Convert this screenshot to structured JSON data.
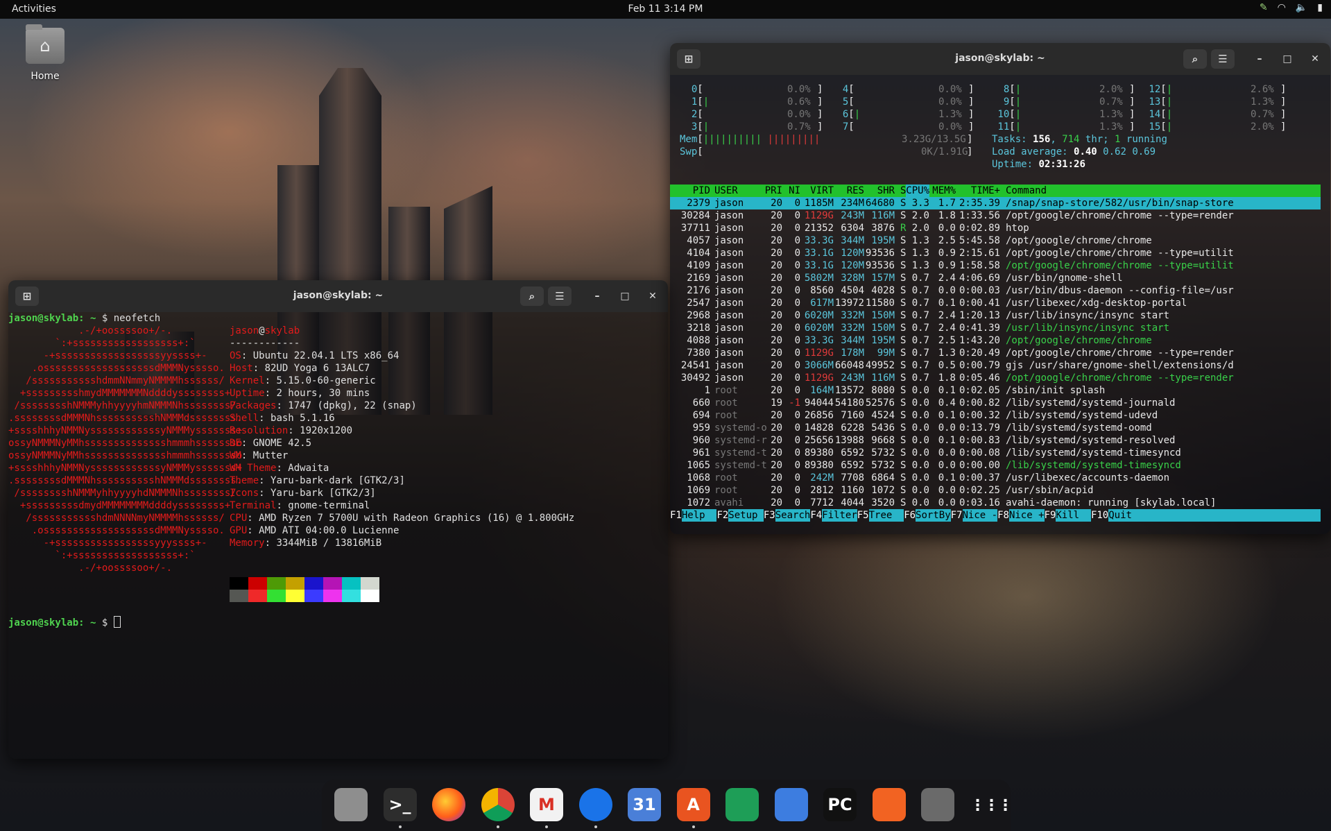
{
  "topbar": {
    "activities": "Activities",
    "clock": "Feb 11  3:14 PM",
    "tray_icons": [
      "pen-icon",
      "wifi-icon",
      "volume-icon",
      "battery-icon"
    ]
  },
  "desktop": {
    "home_label": "Home"
  },
  "neofetch_window": {
    "title": "jason@skylab: ~",
    "prompt_user": "jason@skylab",
    "prompt_path": ": ~",
    "prompt_symbol": " $ ",
    "command": "neofetch",
    "art_lines": [
      "            .-/+oossssoo+/-.",
      "        `:+ssssssssssssssssss+:`",
      "      -+ssssssssssssssssssyyssss+-",
      "    .osssssssssssssssssssdMMMNysssso.",
      "   /ssssssssssshdmmNNmmyNMMMMhssssss/",
      "  +ssssssssshmydMMMMMMMNddddyssssssss+",
      " /sssssssshNMMMyhhyyyyhmNMMMNhssssssss/",
      ".ssssssssdMMMNhsssssssssshNMMMdssssssss.",
      "+sssshhhyNMMNyssssssssssssyNMMMysssssss+",
      "ossyNMMMNyMMhsssssssssssssshmmmhssssssso",
      "ossyNMMMNyMMhsssssssssssssshmmmhssssssso",
      "+sssshhhyNMMNyssssssssssssyNMMMysssssss+",
      ".ssssssssdMMMNhsssssssssshNMMMdssssssss.",
      " /sssssssshNMMMyhhyyyyhdNMMMNhssssssss/",
      "  +sssssssssdmydMMMMMMMMddddyssssssss+",
      "   /ssssssssssshdmNNNNmyNMMMMhssssss/",
      "    .osssssssssssssssssssdMMMNysssso.",
      "      -+sssssssssssssssssyyyssss+-",
      "        `:+ssssssssssssssssss+:`",
      "            .-/+oossssoo+/-."
    ],
    "info_header_user": "jason",
    "info_header_at": "@",
    "info_header_host": "skylab",
    "info_sep": "------------",
    "info": [
      {
        "key": "OS",
        "value": "Ubuntu 22.04.1 LTS x86_64"
      },
      {
        "key": "Host",
        "value": "82UD Yoga 6 13ALC7"
      },
      {
        "key": "Kernel",
        "value": "5.15.0-60-generic"
      },
      {
        "key": "Uptime",
        "value": "2 hours, 30 mins"
      },
      {
        "key": "Packages",
        "value": "1747 (dpkg), 22 (snap)"
      },
      {
        "key": "Shell",
        "value": "bash 5.1.16"
      },
      {
        "key": "Resolution",
        "value": "1920x1200"
      },
      {
        "key": "DE",
        "value": "GNOME 42.5"
      },
      {
        "key": "WM",
        "value": "Mutter"
      },
      {
        "key": "WM Theme",
        "value": "Adwaita"
      },
      {
        "key": "Theme",
        "value": "Yaru-bark-dark [GTK2/3]"
      },
      {
        "key": "Icons",
        "value": "Yaru-bark [GTK2/3]"
      },
      {
        "key": "Terminal",
        "value": "gnome-terminal"
      },
      {
        "key": "CPU",
        "value": "AMD Ryzen 7 5700U with Radeon Graphics (16) @ 1.800GHz"
      },
      {
        "key": "GPU",
        "value": "AMD ATI 04:00.0 Lucienne"
      },
      {
        "key": "Memory",
        "value": "3344MiB / 13816MiB"
      }
    ],
    "palette_top": [
      "#000000",
      "#cc0000",
      "#4e9a06",
      "#c4a000",
      "#1a14cc",
      "#b514b5",
      "#06c1c1",
      "#d3d7cf"
    ],
    "palette_bottom": [
      "#555753",
      "#ef2929",
      "#33e033",
      "#ffff33",
      "#3b3bff",
      "#ee33ee",
      "#33e0e0",
      "#ffffff"
    ]
  },
  "htop_window": {
    "title": "jason@skylab: ~",
    "cpus": [
      {
        "id": "0",
        "pct": "0.0%"
      },
      {
        "id": "1",
        "pct": "0.6%"
      },
      {
        "id": "2",
        "pct": "0.0%"
      },
      {
        "id": "3",
        "pct": "0.7%"
      },
      {
        "id": "4",
        "pct": "0.0%"
      },
      {
        "id": "5",
        "pct": "0.0%"
      },
      {
        "id": "6",
        "pct": "1.3%"
      },
      {
        "id": "7",
        "pct": "0.0%"
      },
      {
        "id": "8",
        "pct": "2.0%"
      },
      {
        "id": "9",
        "pct": "0.7%"
      },
      {
        "id": "10",
        "pct": "1.3%"
      },
      {
        "id": "11",
        "pct": "1.3%"
      },
      {
        "id": "12",
        "pct": "2.6%"
      },
      {
        "id": "13",
        "pct": "1.3%"
      },
      {
        "id": "14",
        "pct": "0.7%"
      },
      {
        "id": "15",
        "pct": "2.0%"
      }
    ],
    "mem_label": "Mem",
    "mem_value": "3.23G/13.5G",
    "swp_label": "Swp",
    "swp_value": "0K/1.91G",
    "tasks_label": "Tasks:",
    "tasks_count": "156",
    "tasks_thr": "714",
    "tasks_rest": " thr; ",
    "tasks_running_count": "1",
    "tasks_running": " running",
    "load_label": "Load average:",
    "load1": "0.40",
    "load5": "0.62",
    "load15": "0.69",
    "uptime_label": "Uptime:",
    "uptime_value": "02:31:26",
    "columns": [
      "PID",
      "USER",
      "PRI",
      "NI",
      "VIRT",
      "RES",
      "SHR",
      "S",
      "CPU%",
      "MEM%",
      "TIME+",
      "Command"
    ],
    "processes": [
      {
        "pid": "2379",
        "user": "jason",
        "pri": "20",
        "ni": "0",
        "virt": "1185M",
        "res": "234M",
        "shr": "64680",
        "s": "S",
        "cpu": "3.3",
        "mem": "1.7",
        "time": "2:35.39",
        "cmd": "/snap/snap-store/582/usr/bin/snap-store",
        "selected": true
      },
      {
        "pid": "30284",
        "user": "jason",
        "pri": "20",
        "ni": "0",
        "virt": "1129G",
        "res": "243M",
        "shr": "116M",
        "s": "S",
        "cpu": "2.0",
        "mem": "1.8",
        "time": "1:33.56",
        "cmd": "/opt/google/chrome/chrome --type=render"
      },
      {
        "pid": "37711",
        "user": "jason",
        "pri": "20",
        "ni": "0",
        "virt": "21352",
        "res": "6304",
        "shr": "3876",
        "s": "R",
        "cpu": "2.0",
        "mem": "0.0",
        "time": "0:02.89",
        "cmd": "htop"
      },
      {
        "pid": "4057",
        "user": "jason",
        "pri": "20",
        "ni": "0",
        "virt": "33.3G",
        "res": "344M",
        "shr": "195M",
        "s": "S",
        "cpu": "1.3",
        "mem": "2.5",
        "time": "5:45.58",
        "cmd": "/opt/google/chrome/chrome"
      },
      {
        "pid": "4104",
        "user": "jason",
        "pri": "20",
        "ni": "0",
        "virt": "33.1G",
        "res": "120M",
        "shr": "93536",
        "s": "S",
        "cpu": "1.3",
        "mem": "0.9",
        "time": "2:15.61",
        "cmd": "/opt/google/chrome/chrome --type=utilit"
      },
      {
        "pid": "4109",
        "user": "jason",
        "pri": "20",
        "ni": "0",
        "virt": "33.1G",
        "res": "120M",
        "shr": "93536",
        "s": "S",
        "cpu": "1.3",
        "mem": "0.9",
        "time": "1:58.58",
        "cmd": "/opt/google/chrome/chrome --type=utilit",
        "thread": true
      },
      {
        "pid": "2169",
        "user": "jason",
        "pri": "20",
        "ni": "0",
        "virt": "5802M",
        "res": "328M",
        "shr": "157M",
        "s": "S",
        "cpu": "0.7",
        "mem": "2.4",
        "time": "4:06.69",
        "cmd": "/usr/bin/gnome-shell"
      },
      {
        "pid": "2176",
        "user": "jason",
        "pri": "20",
        "ni": "0",
        "virt": "8560",
        "res": "4504",
        "shr": "4028",
        "s": "S",
        "cpu": "0.7",
        "mem": "0.0",
        "time": "0:00.03",
        "cmd": "/usr/bin/dbus-daemon --config-file=/usr"
      },
      {
        "pid": "2547",
        "user": "jason",
        "pri": "20",
        "ni": "0",
        "virt": "617M",
        "res": "13972",
        "shr": "11580",
        "s": "S",
        "cpu": "0.7",
        "mem": "0.1",
        "time": "0:00.41",
        "cmd": "/usr/libexec/xdg-desktop-portal"
      },
      {
        "pid": "2968",
        "user": "jason",
        "pri": "20",
        "ni": "0",
        "virt": "6020M",
        "res": "332M",
        "shr": "150M",
        "s": "S",
        "cpu": "0.7",
        "mem": "2.4",
        "time": "1:20.13",
        "cmd": "/usr/lib/insync/insync start"
      },
      {
        "pid": "3218",
        "user": "jason",
        "pri": "20",
        "ni": "0",
        "virt": "6020M",
        "res": "332M",
        "shr": "150M",
        "s": "S",
        "cpu": "0.7",
        "mem": "2.4",
        "time": "0:41.39",
        "cmd": "/usr/lib/insync/insync start",
        "thread": true
      },
      {
        "pid": "4088",
        "user": "jason",
        "pri": "20",
        "ni": "0",
        "virt": "33.3G",
        "res": "344M",
        "shr": "195M",
        "s": "S",
        "cpu": "0.7",
        "mem": "2.5",
        "time": "1:43.20",
        "cmd": "/opt/google/chrome/chrome",
        "thread": true
      },
      {
        "pid": "7380",
        "user": "jason",
        "pri": "20",
        "ni": "0",
        "virt": "1129G",
        "res": "178M",
        "shr": "99M",
        "s": "S",
        "cpu": "0.7",
        "mem": "1.3",
        "time": "0:20.49",
        "cmd": "/opt/google/chrome/chrome --type=render"
      },
      {
        "pid": "24541",
        "user": "jason",
        "pri": "20",
        "ni": "0",
        "virt": "3066M",
        "res": "66048",
        "shr": "49952",
        "s": "S",
        "cpu": "0.7",
        "mem": "0.5",
        "time": "0:00.79",
        "cmd": "gjs /usr/share/gnome-shell/extensions/d"
      },
      {
        "pid": "30492",
        "user": "jason",
        "pri": "20",
        "ni": "0",
        "virt": "1129G",
        "res": "243M",
        "shr": "116M",
        "s": "S",
        "cpu": "0.7",
        "mem": "1.8",
        "time": "0:05.46",
        "cmd": "/opt/google/chrome/chrome --type=render",
        "thread": true
      },
      {
        "pid": "1",
        "user": "root",
        "pri": "20",
        "ni": "0",
        "virt": "164M",
        "res": "13572",
        "shr": "8080",
        "s": "S",
        "cpu": "0.0",
        "mem": "0.1",
        "time": "0:02.05",
        "cmd": "/sbin/init splash"
      },
      {
        "pid": "660",
        "user": "root",
        "pri": "19",
        "ni": "-1",
        "virt": "94044",
        "res": "54180",
        "shr": "52576",
        "s": "S",
        "cpu": "0.0",
        "mem": "0.4",
        "time": "0:00.82",
        "cmd": "/lib/systemd/systemd-journald"
      },
      {
        "pid": "694",
        "user": "root",
        "pri": "20",
        "ni": "0",
        "virt": "26856",
        "res": "7160",
        "shr": "4524",
        "s": "S",
        "cpu": "0.0",
        "mem": "0.1",
        "time": "0:00.32",
        "cmd": "/lib/systemd/systemd-udevd"
      },
      {
        "pid": "959",
        "user": "systemd-o",
        "pri": "20",
        "ni": "0",
        "virt": "14828",
        "res": "6228",
        "shr": "5436",
        "s": "S",
        "cpu": "0.0",
        "mem": "0.0",
        "time": "0:13.79",
        "cmd": "/lib/systemd/systemd-oomd"
      },
      {
        "pid": "960",
        "user": "systemd-r",
        "pri": "20",
        "ni": "0",
        "virt": "25656",
        "res": "13988",
        "shr": "9668",
        "s": "S",
        "cpu": "0.0",
        "mem": "0.1",
        "time": "0:00.83",
        "cmd": "/lib/systemd/systemd-resolved"
      },
      {
        "pid": "961",
        "user": "systemd-t",
        "pri": "20",
        "ni": "0",
        "virt": "89380",
        "res": "6592",
        "shr": "5732",
        "s": "S",
        "cpu": "0.0",
        "mem": "0.0",
        "time": "0:00.08",
        "cmd": "/lib/systemd/systemd-timesyncd"
      },
      {
        "pid": "1065",
        "user": "systemd-t",
        "pri": "20",
        "ni": "0",
        "virt": "89380",
        "res": "6592",
        "shr": "5732",
        "s": "S",
        "cpu": "0.0",
        "mem": "0.0",
        "time": "0:00.00",
        "cmd": "/lib/systemd/systemd-timesyncd",
        "thread": true
      },
      {
        "pid": "1068",
        "user": "root",
        "pri": "20",
        "ni": "0",
        "virt": "242M",
        "res": "7708",
        "shr": "6864",
        "s": "S",
        "cpu": "0.0",
        "mem": "0.1",
        "time": "0:00.37",
        "cmd": "/usr/libexec/accounts-daemon"
      },
      {
        "pid": "1069",
        "user": "root",
        "pri": "20",
        "ni": "0",
        "virt": "2812",
        "res": "1160",
        "shr": "1072",
        "s": "S",
        "cpu": "0.0",
        "mem": "0.0",
        "time": "0:02.25",
        "cmd": "/usr/sbin/acpid"
      },
      {
        "pid": "1072",
        "user": "avahi",
        "pri": "20",
        "ni": "0",
        "virt": "7712",
        "res": "4044",
        "shr": "3520",
        "s": "S",
        "cpu": "0.0",
        "mem": "0.0",
        "time": "0:03.16",
        "cmd": "avahi-daemon: running [skylab.local]"
      }
    ],
    "fkeys": [
      {
        "key": "F1",
        "label": "Help  "
      },
      {
        "key": "F2",
        "label": "Setup "
      },
      {
        "key": "F3",
        "label": "Search"
      },
      {
        "key": "F4",
        "label": "Filter"
      },
      {
        "key": "F5",
        "label": "Tree  "
      },
      {
        "key": "F6",
        "label": "SortBy"
      },
      {
        "key": "F7",
        "label": "Nice -"
      },
      {
        "key": "F8",
        "label": "Nice +"
      },
      {
        "key": "F9",
        "label": "Kill  "
      },
      {
        "key": "F10",
        "label": "Quit"
      }
    ]
  },
  "dock": {
    "items": [
      {
        "name": "files",
        "glyph": "",
        "bg": "#8e8e8e",
        "running": false
      },
      {
        "name": "terminal",
        "glyph": ">_",
        "bg": "#2d2d2d",
        "running": true
      },
      {
        "name": "firefox",
        "glyph": "",
        "bg": "#ff7b1a",
        "running": false
      },
      {
        "name": "chrome",
        "glyph": "",
        "bg": "#dddddd",
        "running": true
      },
      {
        "name": "gmail",
        "glyph": "M",
        "bg": "#f2f2f2",
        "running": true
      },
      {
        "name": "messages",
        "glyph": "",
        "bg": "#1a73e8",
        "running": true
      },
      {
        "name": "calendar",
        "glyph": "31",
        "bg": "#4a7fd8",
        "running": false
      },
      {
        "name": "app-center",
        "glyph": "A",
        "bg": "#e95420",
        "running": true
      },
      {
        "name": "sheets",
        "glyph": "",
        "bg": "#1e9e57",
        "running": false
      },
      {
        "name": "docs",
        "glyph": "",
        "bg": "#3d7de0",
        "running": false
      },
      {
        "name": "pycharm",
        "glyph": "PC",
        "bg": "#111111",
        "running": false
      },
      {
        "name": "sketch",
        "glyph": "",
        "bg": "#f26322",
        "running": false
      },
      {
        "name": "gimp",
        "glyph": "",
        "bg": "#6a6a6a",
        "running": false
      },
      {
        "name": "app-grid",
        "glyph": "",
        "bg": "transparent",
        "running": false
      }
    ]
  }
}
